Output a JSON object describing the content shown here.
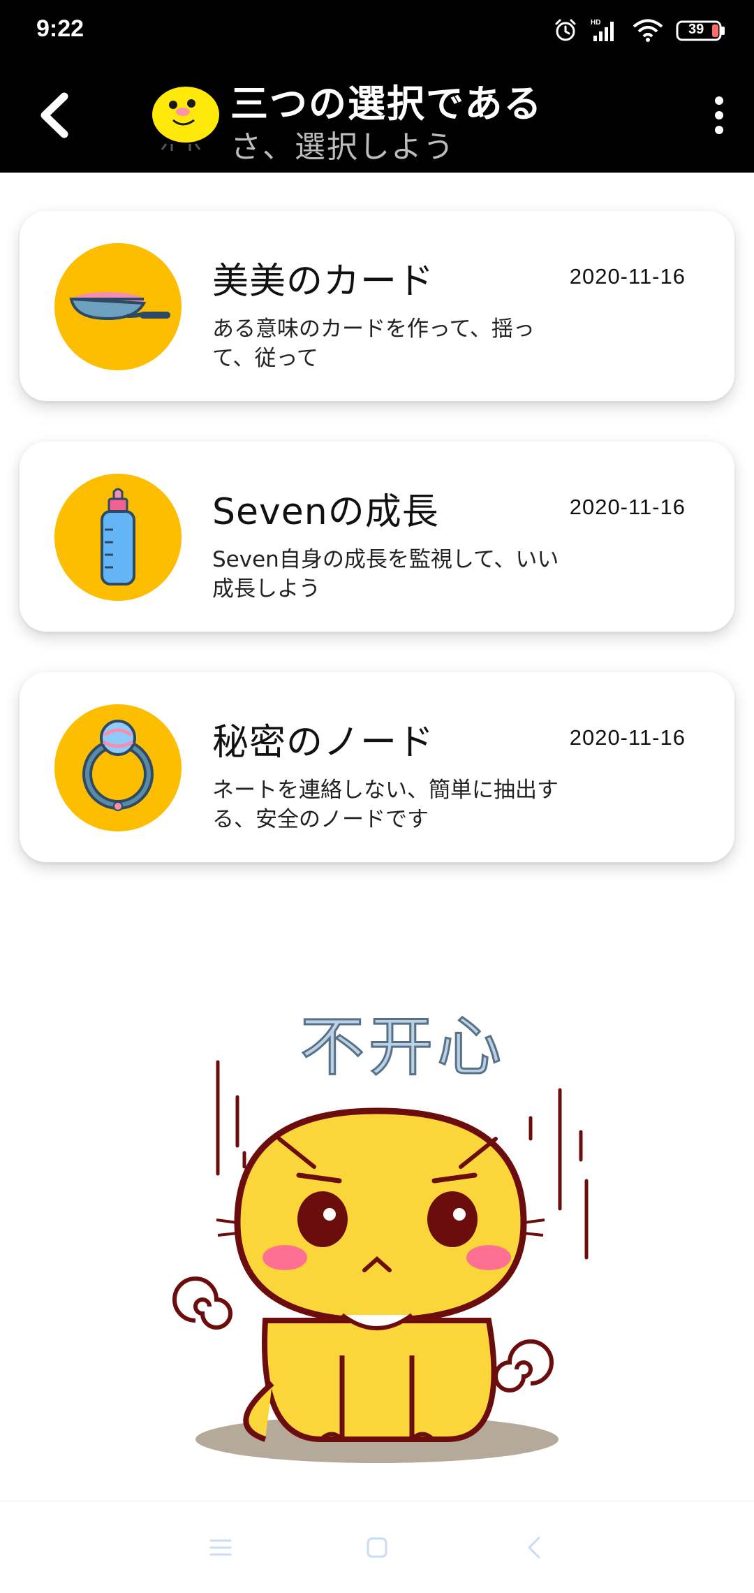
{
  "status_bar": {
    "time": "9:22",
    "battery": "39",
    "icons": [
      "alarm-icon",
      "hd-signal-icon",
      "wifi-icon",
      "battery-icon"
    ]
  },
  "header": {
    "title": "三つの選択である",
    "subtitle": "さ、選択しよう",
    "back_icon": "back-chevron-icon",
    "menu_icon": "more-vertical-icon",
    "avatar_icon": "chick-icon"
  },
  "cards": [
    {
      "title": "美美のカード",
      "date": "2020-11-16",
      "description": "ある意味のカードを作って、揺って、従って",
      "icon": "frying-pan-icon"
    },
    {
      "title": "Sevenの成長",
      "date": "2020-11-16",
      "description": "Seven自身の成長を監視して、いい成長しよう",
      "icon": "baby-bottle-icon"
    },
    {
      "title": "秘密のノード",
      "date": "2020-11-16",
      "description": "ネートを連絡しない、簡単に抽出する、安全のノードです",
      "icon": "baby-rattle-icon"
    }
  ],
  "illustration": {
    "caption": "不开心",
    "icon": "upset-cat-sticker"
  },
  "nav_bar": {
    "icons": [
      "menu-icon",
      "home-square-icon",
      "back-triangle-icon"
    ]
  },
  "colors": {
    "header_bg": "#000000",
    "accent_yellow": "#fdbd00",
    "card_bg": "#ffffff",
    "nav_icon": "#c7dcf5"
  }
}
